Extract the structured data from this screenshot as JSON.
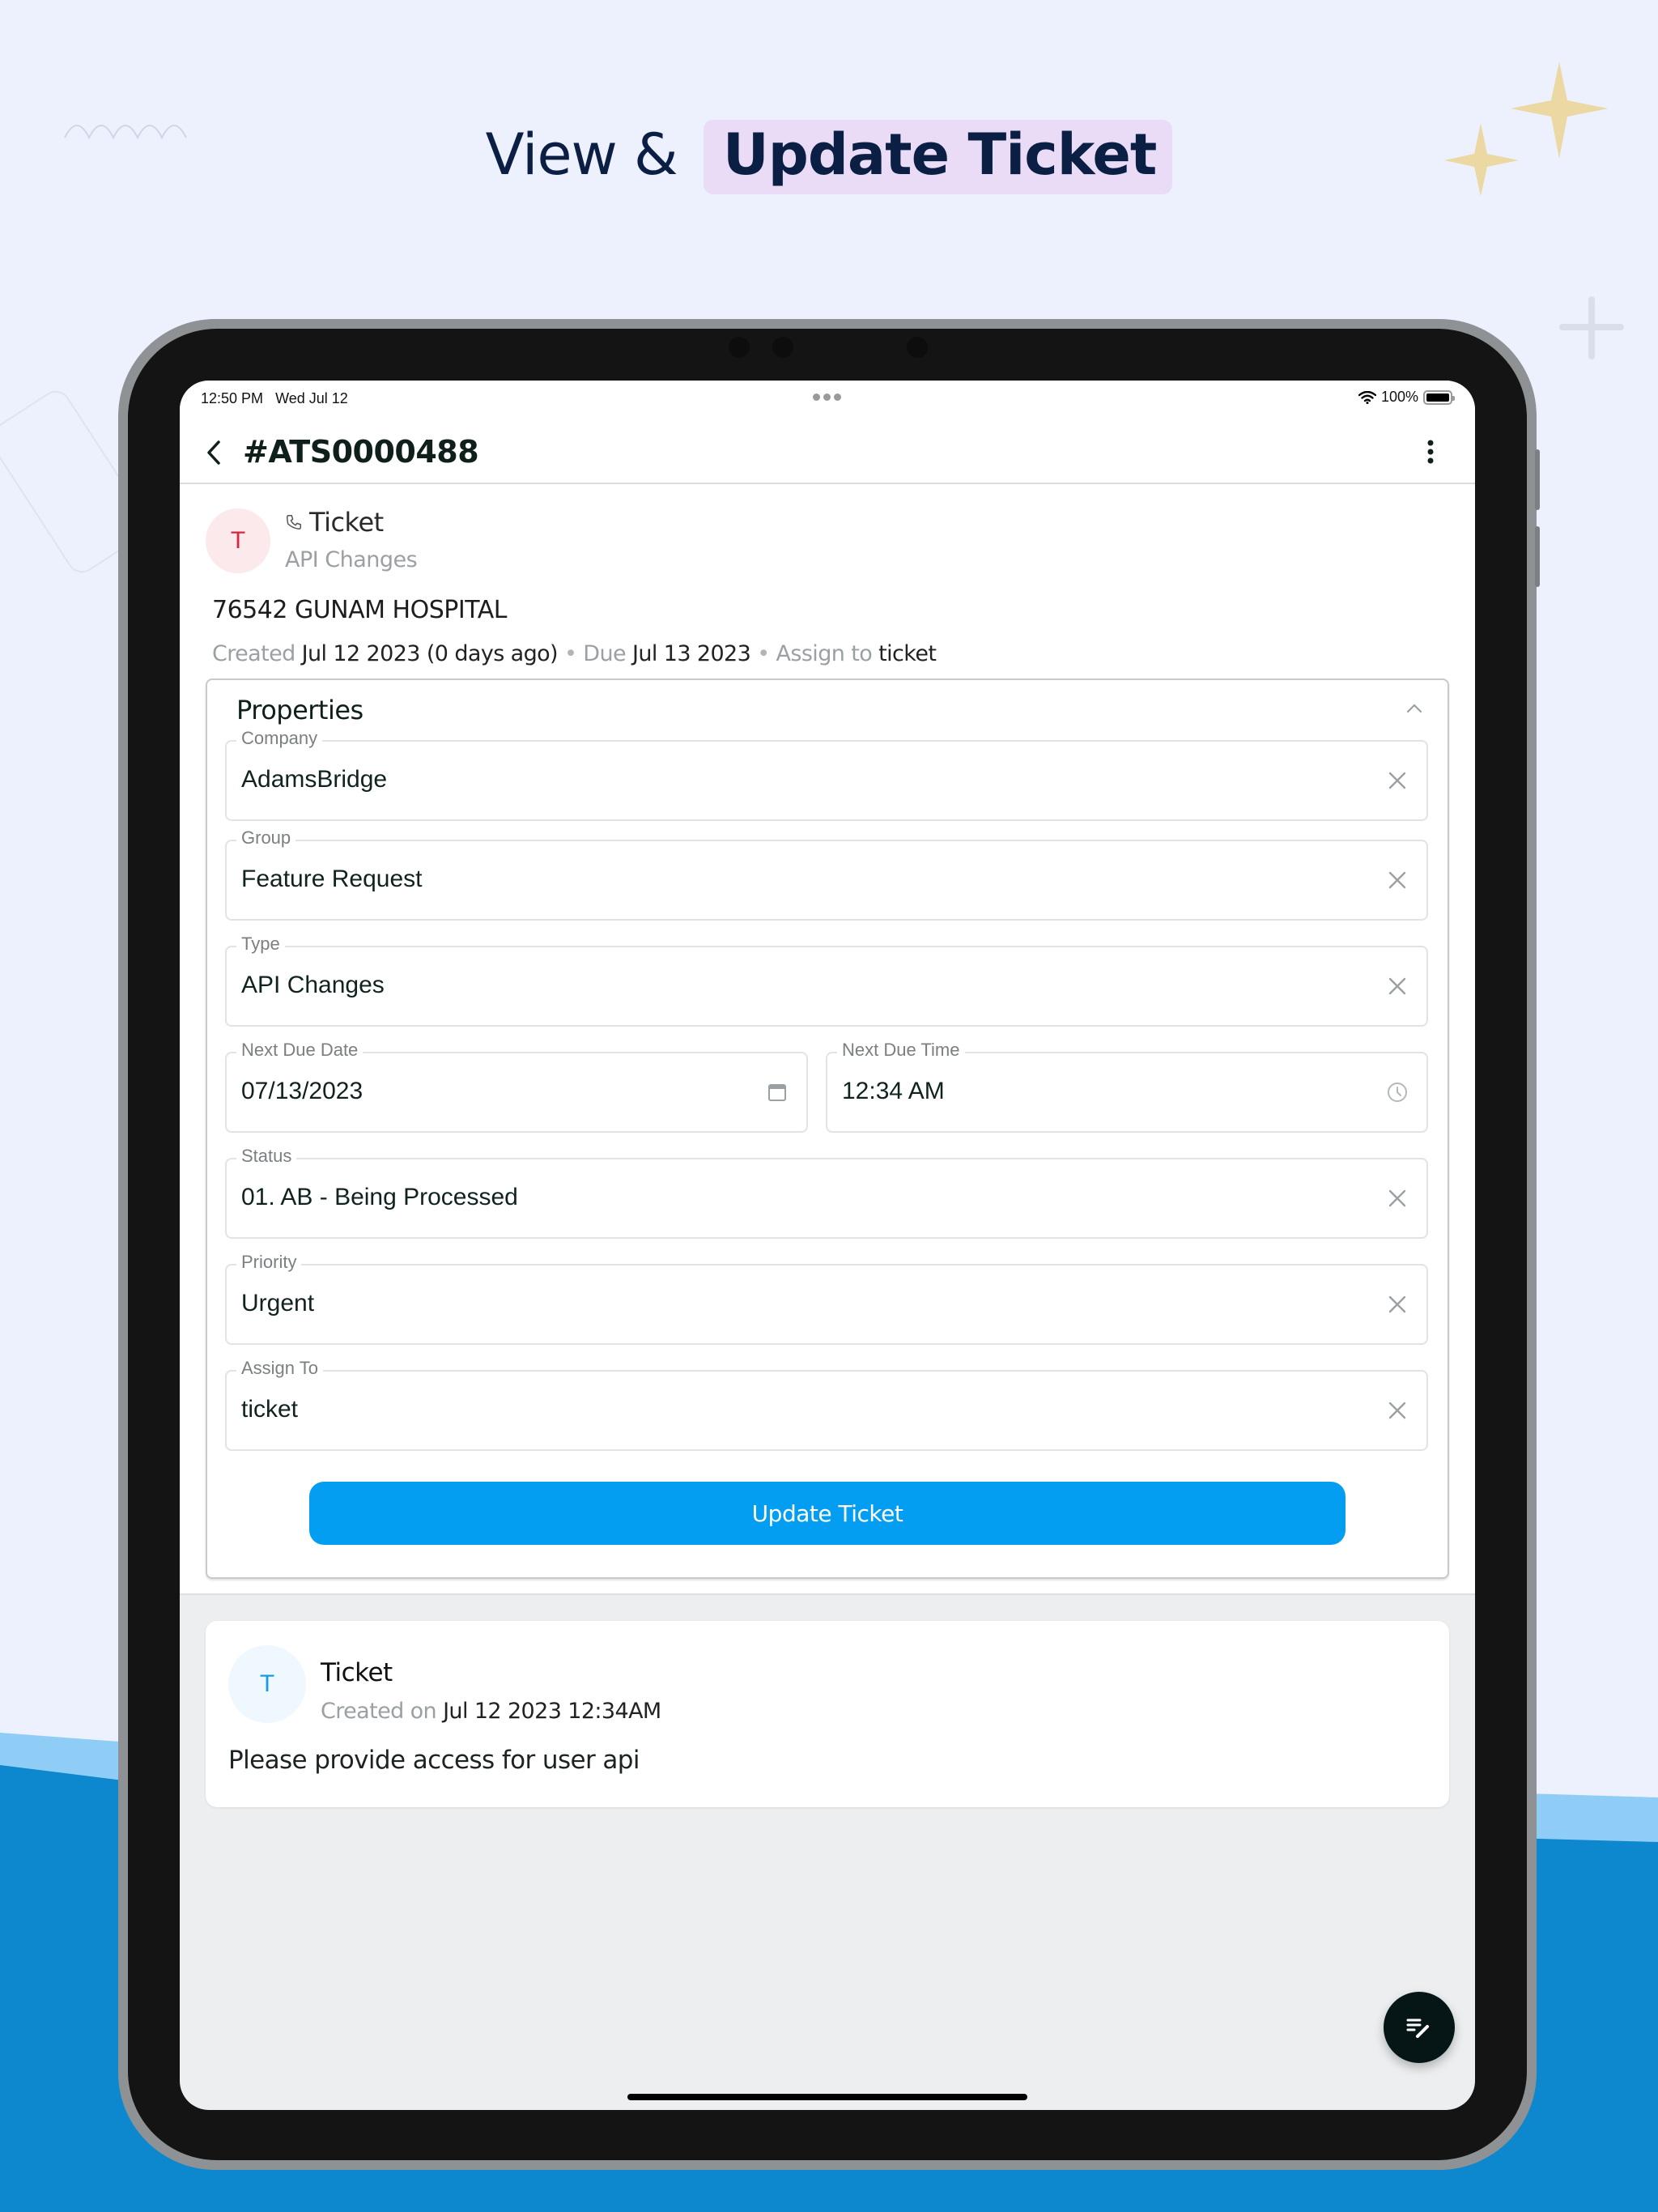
{
  "headline": {
    "prefix": "View &",
    "highlight": "Update Ticket"
  },
  "status_bar": {
    "time": "12:50 PM",
    "date": "Wed Jul 12",
    "battery": "100%"
  },
  "nav": {
    "title": "#ATS0000488",
    "back_icon": "chevron-left-icon",
    "more_icon": "more-vertical-icon"
  },
  "ticket": {
    "avatar_letter": "T",
    "type_icon": "phone-icon",
    "type_label": "Ticket",
    "subtitle": "API Changes",
    "account": "76542 GUNAM HOSPITAL",
    "meta": {
      "created_label": "Created",
      "created_value": "Jul 12 2023 (0 days ago)",
      "separator": "•",
      "due_label": "Due",
      "due_value": "Jul 13 2023",
      "assign_label": "Assign to",
      "assign_value": "ticket"
    }
  },
  "properties": {
    "title": "Properties",
    "fields": [
      {
        "label": "Company",
        "value": "AdamsBridge",
        "icon": "clear-icon"
      },
      {
        "label": "Group",
        "value": "Feature Request",
        "icon": "clear-icon"
      },
      {
        "label": "Type",
        "value": "API Changes",
        "icon": "clear-icon"
      },
      {
        "label": "Next Due Date",
        "value": "07/13/2023",
        "icon": "calendar-icon"
      },
      {
        "label": "Next Due Time",
        "value": "12:34 AM",
        "icon": "clock-icon"
      },
      {
        "label": "Status",
        "value": "01. AB - Being Processed",
        "icon": "clear-icon"
      },
      {
        "label": "Priority",
        "value": "Urgent",
        "icon": "clear-icon"
      },
      {
        "label": "Assign To",
        "value": "ticket",
        "icon": "clear-icon"
      }
    ],
    "update_button": "Update Ticket"
  },
  "comment": {
    "avatar_letter": "T",
    "author": "Ticket",
    "created_label": "Created on",
    "created_value": "Jul 12 2023 12:34AM",
    "body": "Please provide access for user api"
  },
  "fab": {
    "icon": "edit-note-icon"
  },
  "colors": {
    "primary_button": "#039ef1",
    "headline_highlight": "#eadcf6",
    "headline_text": "#0b1f44",
    "avatar_red_text": "#d7263d",
    "avatar_blue_text": "#1a9ae6",
    "fab_bg": "#061617",
    "background_blue": "#0d87cd"
  }
}
